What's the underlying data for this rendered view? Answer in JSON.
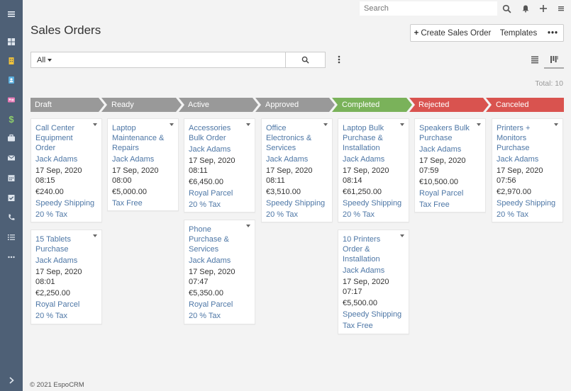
{
  "header": {
    "search_placeholder": "Search"
  },
  "page": {
    "title": "Sales Orders",
    "create_label": "Create Sales Order",
    "templates_label": "Templates",
    "more_label": "•••"
  },
  "filter": {
    "all_label": "All",
    "search_value": ""
  },
  "total_label": "Total: 10",
  "stages": [
    {
      "label": "Draft",
      "color": "#999999"
    },
    {
      "label": "Ready",
      "color": "#999999"
    },
    {
      "label": "Active",
      "color": "#999999"
    },
    {
      "label": "Approved",
      "color": "#999999"
    },
    {
      "label": "Completed",
      "color": "#7ab25a"
    },
    {
      "label": "Rejected",
      "color": "#d9534f"
    },
    {
      "label": "Canceled",
      "color": "#d9534f"
    }
  ],
  "cards": {
    "draft_1": {
      "name": "Call Center Equipment Order",
      "user": "Jack Adams",
      "date": "17 Sep, 2020",
      "time": "08:15",
      "amount": "€240.00",
      "shipping": "Speedy Shipping",
      "tax": "20 % Tax"
    },
    "draft_2": {
      "name": "15 Tablets Purchase",
      "user": "Jack Adams",
      "date": "17 Sep, 2020",
      "time": "08:01",
      "amount": "€2,250.00",
      "shipping": "Royal Parcel",
      "tax": "20 % Tax"
    },
    "ready_1": {
      "name": "Laptop Maintenance & Repairs",
      "user": "Jack Adams",
      "date": "17 Sep, 2020",
      "time": "08:00",
      "amount": "€5,000.00",
      "tax": "Tax Free"
    },
    "active_1": {
      "name": "Accessories Bulk Order",
      "user": "Jack Adams",
      "date": "17 Sep, 2020",
      "time": "08:11",
      "amount": "€6,450.00",
      "shipping": "Royal Parcel",
      "tax": "20 % Tax"
    },
    "active_2": {
      "name": "Phone Purchase & Services",
      "user": "Jack Adams",
      "date": "17 Sep, 2020",
      "time": "07:47",
      "amount": "€5,350.00",
      "shipping": "Royal Parcel",
      "tax": "20 % Tax"
    },
    "approved_1": {
      "name": "Office Electronics & Services",
      "user": "Jack Adams",
      "date": "17 Sep, 2020",
      "time": "08:11",
      "amount": "€3,510.00",
      "shipping": "Speedy Shipping",
      "tax": "20 % Tax"
    },
    "completed_1": {
      "name": "Laptop Bulk Purchase & Installation",
      "user": "Jack Adams",
      "date": "17 Sep, 2020",
      "time": "08:14",
      "amount": "€61,250.00",
      "shipping": "Speedy Shipping",
      "tax": "20 % Tax"
    },
    "completed_2": {
      "name": "10 Printers Order & Installation",
      "user": "Jack Adams",
      "date": "17 Sep, 2020",
      "time": "07:17",
      "amount": "€5,500.00",
      "shipping": "Speedy Shipping",
      "tax": "Tax Free"
    },
    "rejected_1": {
      "name": "Speakers Bulk Purchase",
      "user": "Jack Adams",
      "date": "17 Sep, 2020",
      "time": "07:59",
      "amount": "€10,500.00",
      "shipping": "Royal Parcel",
      "tax": "Tax Free"
    },
    "canceled_1": {
      "name": "Printers + Monitors Purchase",
      "user": "Jack Adams",
      "date": "17 Sep, 2020",
      "time": "07:56",
      "amount": "€2,970.00",
      "shipping": "Speedy Shipping",
      "tax": "20 % Tax"
    }
  },
  "footer": {
    "copyright": "© 2021 EspoCRM"
  }
}
